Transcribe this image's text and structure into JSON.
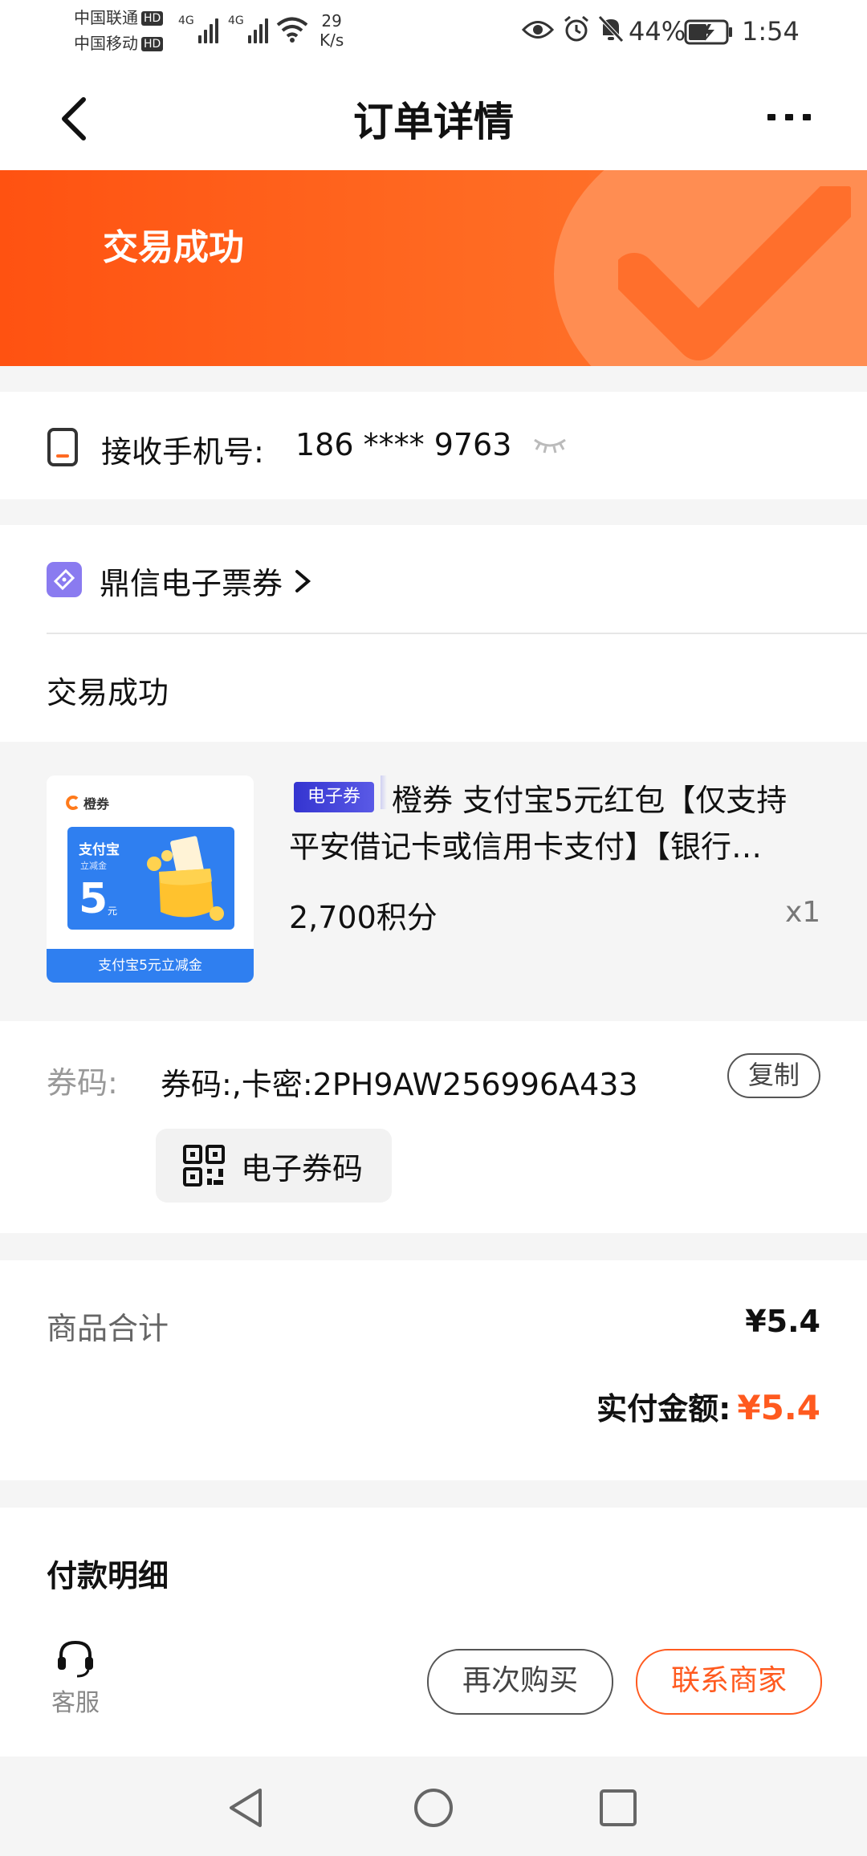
{
  "status_bar": {
    "carrier_1": "中国联通",
    "carrier_2": "中国移动",
    "hd": "HD",
    "net": "4G",
    "speed_value": "29",
    "speed_unit": "K/s",
    "battery": "44%",
    "time": "1:54"
  },
  "header": {
    "title": "订单详情"
  },
  "banner": {
    "status": "交易成功"
  },
  "phone": {
    "label": "接收手机号:",
    "value": "186 **** 9763"
  },
  "store": {
    "name": "鼎信电子票券",
    "order_status": "交易成功"
  },
  "product": {
    "thumb_brand": "橙券",
    "thumb_title": "支付宝",
    "thumb_sub": "立减金",
    "thumb_amount": "5",
    "thumb_unit": "元",
    "thumb_footer": "支付宝5元立减金",
    "tag": "电子券",
    "title_line1": "橙券 支付宝5元红包【仅支持",
    "title_line2": "平安借记卡或信用卡支付】【银行…",
    "price": "2,700积分",
    "qty": "x1"
  },
  "coupon": {
    "label": "券码:",
    "code": "券码:,卡密:2PH9AW256996A433",
    "copy": "复制",
    "qr_button": "电子券码"
  },
  "summary": {
    "goods_label": "商品合计",
    "goods_value": "¥5.4",
    "paid_label": "实付金额:",
    "paid_value": "¥5.4"
  },
  "payment": {
    "title": "付款明细"
  },
  "bottom": {
    "service": "客服",
    "rebuy": "再次购买",
    "contact": "联系商家"
  },
  "colors": {
    "accent": "#ff5a1f",
    "tag": "#3b3bd6"
  }
}
